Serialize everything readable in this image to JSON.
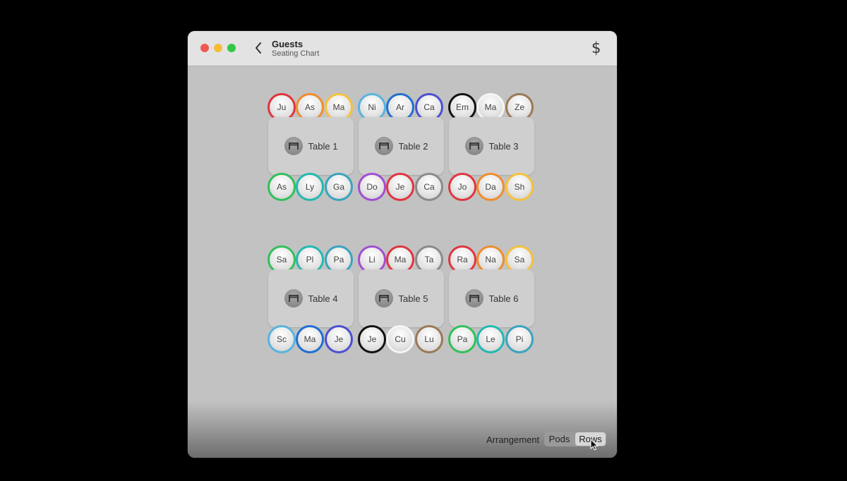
{
  "window": {
    "title": "Guests",
    "subtitle": "Seating Chart",
    "back_icon": "chevron-left-icon",
    "action_icon": "dollar-icon",
    "action_label": "$"
  },
  "colors": {
    "red": "#e0353f",
    "orange": "#f08c2e",
    "yellow": "#f4c33c",
    "lightblue": "#58b4de",
    "blue": "#1f6fd1",
    "indigo": "#4d4fd0",
    "black": "#111111",
    "white": "#f5f5f5",
    "brown": "#9a7a55",
    "green": "#31c05a",
    "teal": "#23b9b0",
    "tealblue": "#3aa3bd",
    "purple": "#a04fd0",
    "gray": "#8a8a8a"
  },
  "tables": [
    {
      "label": "Table 1",
      "top": [
        {
          "name": "Ju",
          "color": "red"
        },
        {
          "name": "As",
          "color": "orange"
        },
        {
          "name": "Ma",
          "color": "yellow"
        }
      ],
      "bottom": [
        {
          "name": "As",
          "color": "green"
        },
        {
          "name": "Ly",
          "color": "teal"
        },
        {
          "name": "Ga",
          "color": "tealblue"
        }
      ]
    },
    {
      "label": "Table 2",
      "top": [
        {
          "name": "Ni",
          "color": "lightblue"
        },
        {
          "name": "Ar",
          "color": "blue"
        },
        {
          "name": "Ca",
          "color": "indigo"
        }
      ],
      "bottom": [
        {
          "name": "Do",
          "color": "purple"
        },
        {
          "name": "Je",
          "color": "red"
        },
        {
          "name": "Ca",
          "color": "gray"
        }
      ]
    },
    {
      "label": "Table 3",
      "top": [
        {
          "name": "Em",
          "color": "black"
        },
        {
          "name": "Ma",
          "color": "white"
        },
        {
          "name": "Ze",
          "color": "brown"
        }
      ],
      "bottom": [
        {
          "name": "Jo",
          "color": "red"
        },
        {
          "name": "Da",
          "color": "orange"
        },
        {
          "name": "Sh",
          "color": "yellow"
        }
      ]
    },
    {
      "label": "Table 4",
      "top": [
        {
          "name": "Sa",
          "color": "green"
        },
        {
          "name": "Pl",
          "color": "teal"
        },
        {
          "name": "Pa",
          "color": "tealblue"
        }
      ],
      "bottom": [
        {
          "name": "Sc",
          "color": "lightblue"
        },
        {
          "name": "Ma",
          "color": "blue"
        },
        {
          "name": "Je",
          "color": "indigo"
        }
      ]
    },
    {
      "label": "Table 5",
      "top": [
        {
          "name": "Li",
          "color": "purple"
        },
        {
          "name": "Ma",
          "color": "red"
        },
        {
          "name": "Ta",
          "color": "gray"
        }
      ],
      "bottom": [
        {
          "name": "Je",
          "color": "black"
        },
        {
          "name": "Cu",
          "color": "white"
        },
        {
          "name": "Lu",
          "color": "brown"
        }
      ]
    },
    {
      "label": "Table 6",
      "top": [
        {
          "name": "Ra",
          "color": "red"
        },
        {
          "name": "Na",
          "color": "orange"
        },
        {
          "name": "Sa",
          "color": "yellow"
        }
      ],
      "bottom": [
        {
          "name": "Pa",
          "color": "green"
        },
        {
          "name": "Le",
          "color": "teal"
        },
        {
          "name": "Pi",
          "color": "tealblue"
        }
      ]
    }
  ],
  "table_icon": "table-icon",
  "footer": {
    "arrangement_label": "Arrangement",
    "options": [
      "Pods",
      "Rows"
    ],
    "selected": "Rows"
  }
}
